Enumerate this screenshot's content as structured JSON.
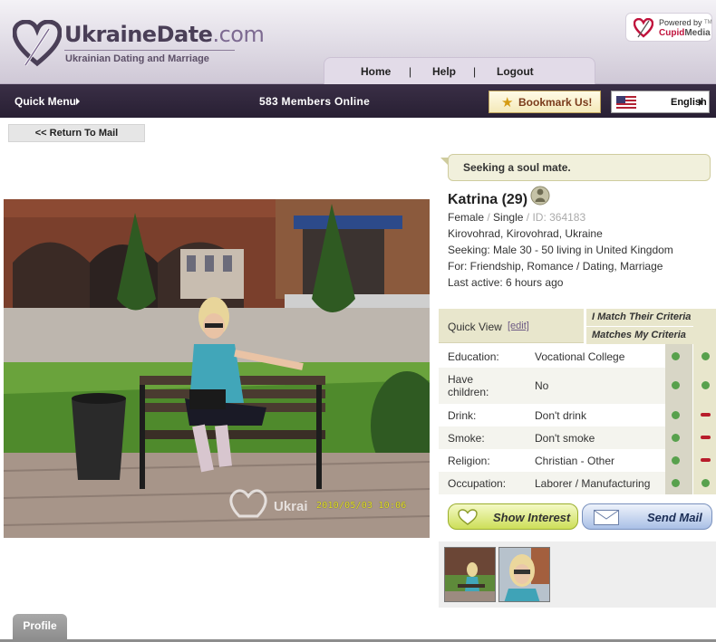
{
  "brand": {
    "name_main": "UkraineDate",
    "name_domain": ".com",
    "tagline": "Ukrainian Dating and Marriage",
    "powered_by": "Powered by",
    "powered_brand_a": "Cupid",
    "powered_brand_b": "Media",
    "powered_tm": "TM"
  },
  "nav": {
    "home": "Home",
    "help": "Help",
    "logout": "Logout",
    "separator": "|"
  },
  "menubar": {
    "quick_menu": "Quick Menu",
    "members_online": "583 Members Online",
    "bookmark": "Bookmark Us!",
    "language": "English"
  },
  "return_to_mail": "<< Return To Mail",
  "photo": {
    "watermark": "Ukrai",
    "date_stamp": "2010/05/03 10:06"
  },
  "profile": {
    "headline": "Seeking a soul mate.",
    "name": "Katrina (29)",
    "gender": "Female",
    "status": "Single",
    "id": "ID: 364183",
    "location": "Kirovohrad, Kirovohrad, Ukraine",
    "seeking": "Seeking: Male 30 - 50 living in United Kingdom",
    "for": "For: Friendship, Romance / Dating, Marriage",
    "last_active": "Last active: 6 hours ago"
  },
  "quick_view": {
    "title": "Quick View",
    "edit": "[edit]",
    "i_match": "I Match Their Criteria",
    "matches_my": "Matches My Criteria",
    "rows": [
      {
        "label": "Education:",
        "value": "Vocational College",
        "i_match": true,
        "matches_my": true
      },
      {
        "label": "Have children:",
        "value": "No",
        "i_match": true,
        "matches_my": true
      },
      {
        "label": "Drink:",
        "value": "Don't drink",
        "i_match": true,
        "matches_my": false
      },
      {
        "label": "Smoke:",
        "value": "Don't smoke",
        "i_match": true,
        "matches_my": false
      },
      {
        "label": "Religion:",
        "value": "Christian - Other",
        "i_match": true,
        "matches_my": false
      },
      {
        "label": "Occupation:",
        "value": "Laborer / Manufacturing",
        "i_match": true,
        "matches_my": true
      }
    ]
  },
  "actions": {
    "show_interest": "Show Interest",
    "send_mail": "Send Mail"
  },
  "tabs": {
    "profile": "Profile"
  },
  "colors": {
    "menubar": "#2f2539",
    "header_purple": "#4a3f57",
    "match_green": "#58a14d",
    "nomatch_red": "#b81d2b",
    "interest_green": "#cddf59",
    "mail_blue": "#a9bfe6"
  }
}
